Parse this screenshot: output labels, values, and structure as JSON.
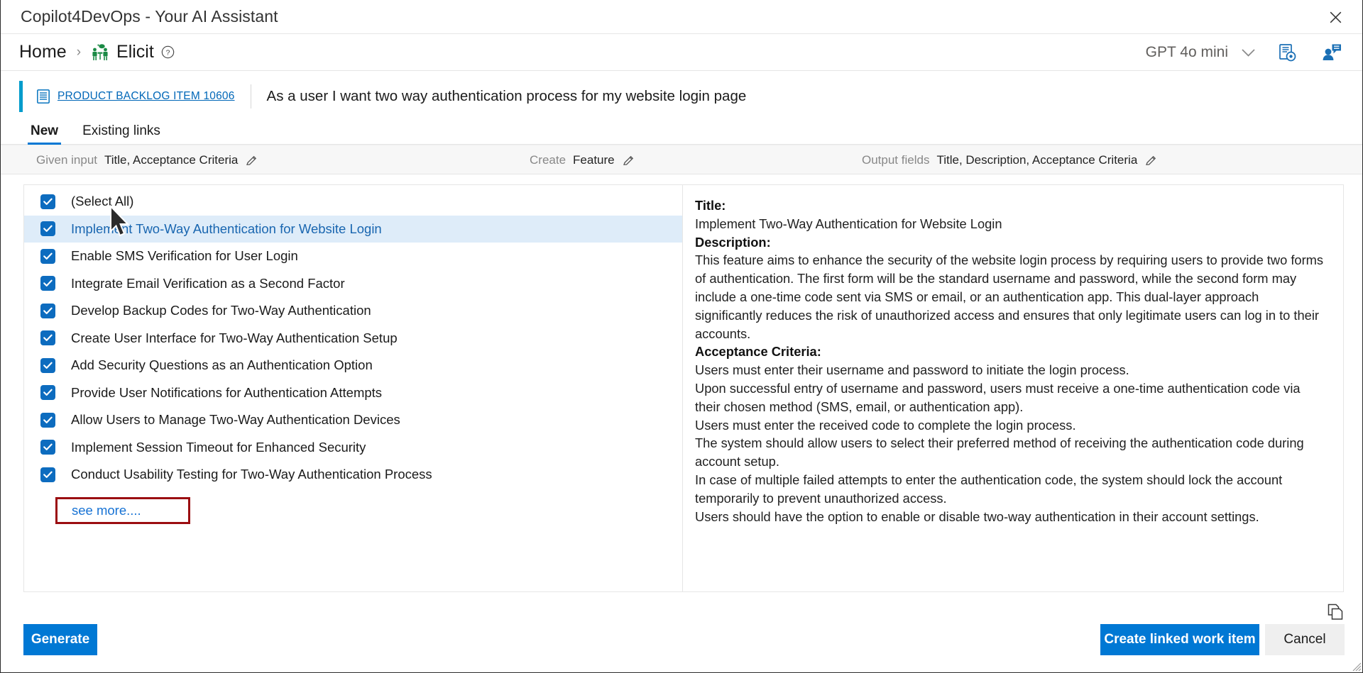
{
  "window": {
    "title": "Copilot4DevOps - Your AI Assistant",
    "close_label": "✕"
  },
  "breadcrumb": {
    "home": "Home",
    "separator": "›",
    "current": "Elicit",
    "help_tooltip": "?",
    "elicit_icon": "people-table-icon",
    "help_icon": "help-circle-icon"
  },
  "header_right": {
    "model_name": "GPT 4o mini",
    "chevron_icon": "chevron-down-icon",
    "settings_icon": "document-settings-icon",
    "profile_icon": "user-chat-icon"
  },
  "work_item": {
    "type_icon": "backlog-item-icon",
    "id_label": "PRODUCT BACKLOG ITEM 10606",
    "title": "As a user I want two way authentication process for my website login page",
    "accent_color": "#009ccc"
  },
  "tabs": [
    {
      "label": "New",
      "active": true
    },
    {
      "label": "Existing links",
      "active": false
    }
  ],
  "controls": {
    "given_input": {
      "label": "Given input",
      "value": "Title, Acceptance Criteria",
      "edit_icon": "pencil-icon"
    },
    "create": {
      "label": "Create",
      "value": "Feature",
      "edit_icon": "pencil-icon"
    },
    "output_fields": {
      "label": "Output fields",
      "value": "Title, Description, Acceptance Criteria",
      "edit_icon": "pencil-icon"
    }
  },
  "list": {
    "items": [
      {
        "label": "(Select All)",
        "checked": true,
        "selected": false
      },
      {
        "label": "Implement Two-Way Authentication for Website Login",
        "checked": true,
        "selected": true
      },
      {
        "label": "Enable SMS Verification for User Login",
        "checked": true,
        "selected": false
      },
      {
        "label": "Integrate Email Verification as a Second Factor",
        "checked": true,
        "selected": false
      },
      {
        "label": "Develop Backup Codes for Two-Way Authentication",
        "checked": true,
        "selected": false
      },
      {
        "label": "Create User Interface for Two-Way Authentication Setup",
        "checked": true,
        "selected": false
      },
      {
        "label": "Add Security Questions as an Authentication Option",
        "checked": true,
        "selected": false
      },
      {
        "label": "Provide User Notifications for Authentication Attempts",
        "checked": true,
        "selected": false
      },
      {
        "label": "Allow Users to Manage Two-Way Authentication Devices",
        "checked": true,
        "selected": false
      },
      {
        "label": "Implement Session Timeout for Enhanced Security",
        "checked": true,
        "selected": false
      },
      {
        "label": "Conduct Usability Testing for Two-Way Authentication Process",
        "checked": true,
        "selected": false
      }
    ],
    "see_more_label": "see more....",
    "see_more_highlight_color": "#9b0d11",
    "cursor_icon": "mouse-pointer-icon"
  },
  "detail": {
    "title_heading": "Title:",
    "title_value": "Implement Two-Way Authentication for Website Login",
    "description_heading": "Description:",
    "description_value": "This feature aims to enhance the security of the website login process by requiring users to provide two forms of authentication. The first form will be the standard username and password, while the second form may include a one-time code sent via SMS or email, or an authentication app. This dual-layer approach significantly reduces the risk of unauthorized access and ensures that only legitimate users can log in to their accounts.",
    "acceptance_heading": "Acceptance Criteria:",
    "acceptance_items": [
      "Users must enter their username and password to initiate the login process.",
      "Upon successful entry of username and password, users must receive a one-time authentication code via their chosen method (SMS, email, or authentication app).",
      "Users must enter the received code to complete the login process.",
      "The system should allow users to select their preferred method of receiving the authentication code during account setup.",
      "In case of multiple failed attempts to enter the authentication code, the system should lock the account temporarily to prevent unauthorized access.",
      "Users should have the option to enable or disable two-way authentication in their account settings."
    ]
  },
  "footer": {
    "copy_icon": "copy-icon",
    "generate_label": "Generate",
    "create_linked_label": "Create linked work item",
    "cancel_label": "Cancel",
    "primary_color": "#0078d4"
  }
}
